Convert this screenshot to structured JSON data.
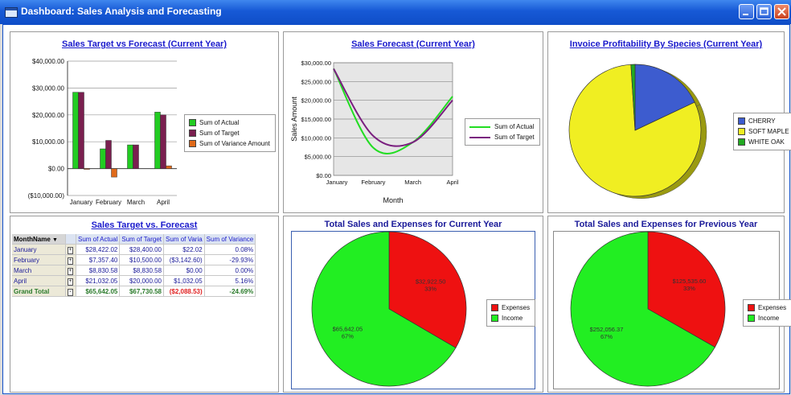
{
  "window": {
    "title": "Dashboard: Sales Analysis and Forecasting"
  },
  "panels": {
    "p1": {
      "title": "Sales Target vs Forecast (Current Year)"
    },
    "p2": {
      "title": "Sales Forecast (Current Year)"
    },
    "p3": {
      "title": "Invoice Profitability By Species (Current Year)"
    },
    "p4": {
      "title": "Sales Target vs. Forecast"
    },
    "p5": {
      "title": "Total Sales and Expenses for Current Year"
    },
    "p6": {
      "title": "Total Sales and Expenses for Previous Year"
    }
  },
  "chart_data": [
    {
      "type": "bar",
      "categories": [
        "January",
        "February",
        "March",
        "April"
      ],
      "series": [
        {
          "name": "Sum of Actual",
          "values": [
            28422.02,
            7357.4,
            8830.58,
            21032.05
          ],
          "color": "#22cc22"
        },
        {
          "name": "Sum of Target",
          "values": [
            28400,
            10500,
            8830.58,
            20000
          ],
          "color": "#7a1f4f"
        },
        {
          "name": "Sum of Variance Amount",
          "values": [
            22.02,
            -3142.6,
            0,
            1032.05
          ],
          "color": "#e06a1a"
        }
      ],
      "ylim": [
        -10000,
        40000
      ],
      "yticks": [
        "$40,000.00",
        "$30,000.00",
        "$20,000.00",
        "$10,000.00",
        "$0.00",
        "($10,000.00)"
      ],
      "legend": "right",
      "grid": true
    },
    {
      "type": "line",
      "categories": [
        "January",
        "February",
        "March",
        "April"
      ],
      "series": [
        {
          "name": "Sum of Actual",
          "values": [
            28422.02,
            7357.4,
            8830.58,
            21032.05
          ],
          "color": "#22dd22"
        },
        {
          "name": "Sum of Target",
          "values": [
            28400,
            10500,
            8830.58,
            20000
          ],
          "color": "#7a1f7f"
        }
      ],
      "ylim": [
        0,
        30000
      ],
      "yticks": [
        "$30,000.00",
        "$25,000.00",
        "$20,000.00",
        "$15,000.00",
        "$10,000.00",
        "$5,000.00",
        "$0.00"
      ],
      "ylabel": "Sales Amount",
      "xlabel": "Month",
      "legend": "right",
      "grid": true
    },
    {
      "type": "pie",
      "slices": [
        {
          "name": "CHERRY",
          "value": 18,
          "color": "#3d5ccf"
        },
        {
          "name": "SOFT MAPLE",
          "value": 81,
          "color": "#f0ee22"
        },
        {
          "name": "WHITE OAK",
          "value": 1,
          "color": "#22aa22"
        }
      ],
      "legend": "right"
    },
    {
      "type": "pie",
      "slices": [
        {
          "name": "Expenses",
          "value": 32922.5,
          "label": "$32,922.50",
          "pct": "33%",
          "color": "#ee1111"
        },
        {
          "name": "Income",
          "value": 65642.05,
          "label": "$65,642.05",
          "pct": "67%",
          "color": "#22ee22"
        }
      ],
      "legend": "right"
    },
    {
      "type": "pie",
      "slices": [
        {
          "name": "Expenses",
          "value": 125535.6,
          "label": "$125,535.60",
          "pct": "33%",
          "color": "#ee1111"
        },
        {
          "name": "Income",
          "value": 252056.37,
          "label": "$252,056.37",
          "pct": "67%",
          "color": "#22ee22"
        }
      ],
      "legend": "right"
    }
  ],
  "pivot": {
    "headers": [
      "MonthName",
      "Sum of Actual",
      "Sum of Target",
      "Sum of Varia",
      "Sum of Variance"
    ],
    "rows": [
      {
        "month": "January",
        "actual": "$28,422.02",
        "target": "$28,400.00",
        "var": "$22.02",
        "pct": "0.08%"
      },
      {
        "month": "February",
        "actual": "$7,357.40",
        "target": "$10,500.00",
        "var": "($3,142.60)",
        "pct": "-29.93%"
      },
      {
        "month": "March",
        "actual": "$8,830.58",
        "target": "$8,830.58",
        "var": "$0.00",
        "pct": "0.00%"
      },
      {
        "month": "April",
        "actual": "$21,032.05",
        "target": "$20,000.00",
        "var": "$1,032.05",
        "pct": "5.16%"
      }
    ],
    "total": {
      "month": "Grand Total",
      "actual": "$65,642.05",
      "target": "$67,730.58",
      "var": "($2,088.53)",
      "pct": "-24.69%"
    }
  }
}
